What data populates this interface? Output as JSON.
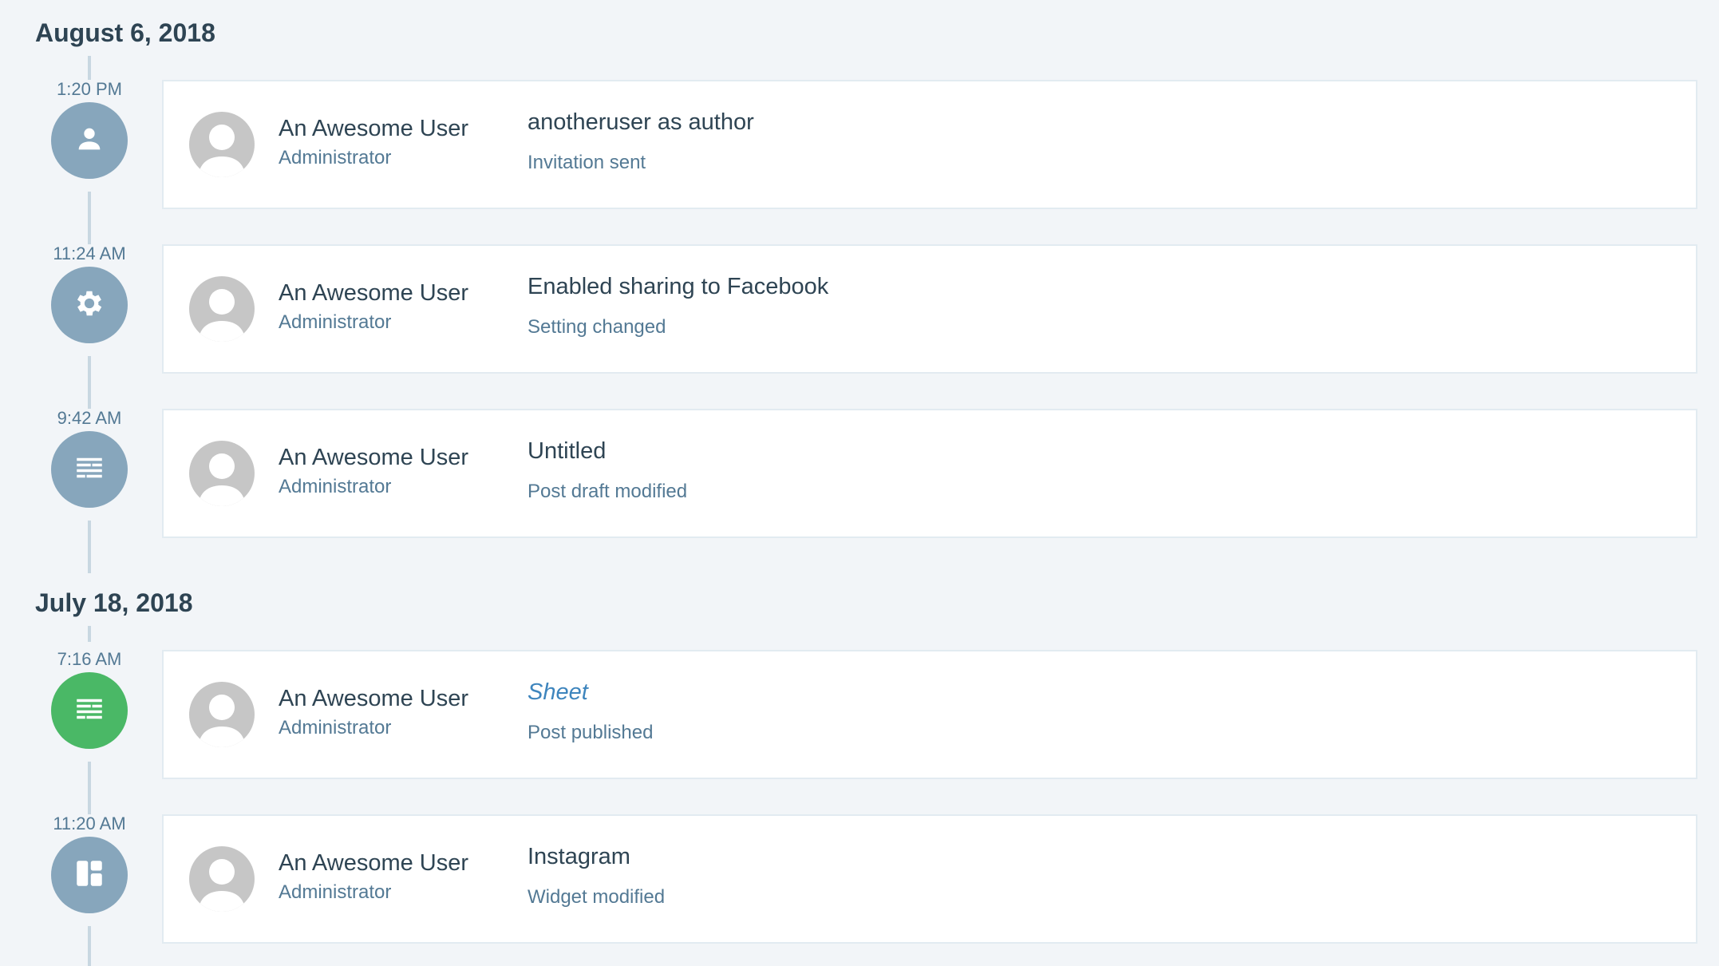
{
  "groups": [
    {
      "date": "August 6, 2018",
      "events": [
        {
          "time": "1:20 PM",
          "icon": "person-icon",
          "user": "An Awesome User",
          "role": "Administrator",
          "title": "anotheruser as author",
          "description": "Invitation sent"
        },
        {
          "time": "11:24 AM",
          "icon": "gear-icon",
          "user": "An Awesome User",
          "role": "Administrator",
          "title": "Enabled sharing to Facebook",
          "description": "Setting changed"
        },
        {
          "time": "9:42 AM",
          "icon": "post-icon",
          "user": "An Awesome User",
          "role": "Administrator",
          "title": "Untitled",
          "description": "Post draft modified"
        }
      ]
    },
    {
      "date": "July 18, 2018",
      "events": [
        {
          "time": "7:16 AM",
          "icon": "post-icon",
          "user": "An Awesome User",
          "role": "Administrator",
          "title": "Sheet",
          "description": "Post published"
        },
        {
          "time": "11:20 AM",
          "icon": "widget-icon",
          "user": "An Awesome User",
          "role": "Administrator",
          "title": "Instagram",
          "description": "Widget modified"
        }
      ]
    }
  ],
  "colors": {
    "badge_default": "#87a6bc",
    "badge_published": "#4ab866",
    "link": "#3e85bd",
    "timeline_line": "#c8d7e1",
    "background": "#f2f5f8"
  }
}
